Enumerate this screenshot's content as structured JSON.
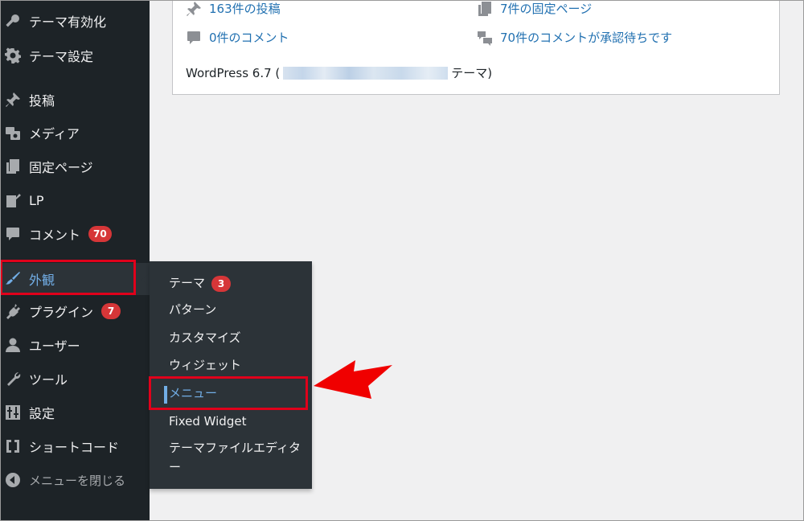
{
  "sidebar": {
    "items": [
      {
        "label": "テーマ有効化",
        "icon": "key-icon"
      },
      {
        "label": "テーマ設定",
        "icon": "gear-icon"
      },
      {
        "label": "投稿",
        "icon": "pushpin-icon"
      },
      {
        "label": "メディア",
        "icon": "media-icon"
      },
      {
        "label": "固定ページ",
        "icon": "pages-icon"
      },
      {
        "label": "LP",
        "icon": "edit-page-icon"
      },
      {
        "label": "コメント",
        "icon": "comment-icon",
        "badge": "70"
      },
      {
        "label": "外観",
        "icon": "appearance-brush-icon",
        "active": true
      },
      {
        "label": "プラグイン",
        "icon": "plugin-icon",
        "badge": "7"
      },
      {
        "label": "ユーザー",
        "icon": "user-icon"
      },
      {
        "label": "ツール",
        "icon": "wrench-icon"
      },
      {
        "label": "設定",
        "icon": "settings-sliders-icon"
      },
      {
        "label": "ショートコード",
        "icon": "shortcode-brackets-icon"
      }
    ],
    "collapse_label": "メニューを閉じる"
  },
  "submenu": {
    "items": [
      {
        "label": "テーマ",
        "badge": "3"
      },
      {
        "label": "パターン"
      },
      {
        "label": "カスタマイズ"
      },
      {
        "label": "ウィジェット"
      },
      {
        "label": "メニュー",
        "current": true
      },
      {
        "label": "Fixed Widget"
      },
      {
        "label": "テーマファイルエディター"
      }
    ]
  },
  "at_a_glance": {
    "posts": "163件の投稿",
    "pages": "7件の固定ページ",
    "comments": "0件のコメント",
    "pending": "70件のコメントが承認待ちです",
    "version_prefix": "WordPress 6.7 (",
    "version_suffix": "テーマ)"
  },
  "colors": {
    "sidebar_bg": "#1d2327",
    "flyout_bg": "#2c3338",
    "link": "#2271b1",
    "active": "#72aee6",
    "badge": "#d63638",
    "highlight": "#e0001b"
  }
}
